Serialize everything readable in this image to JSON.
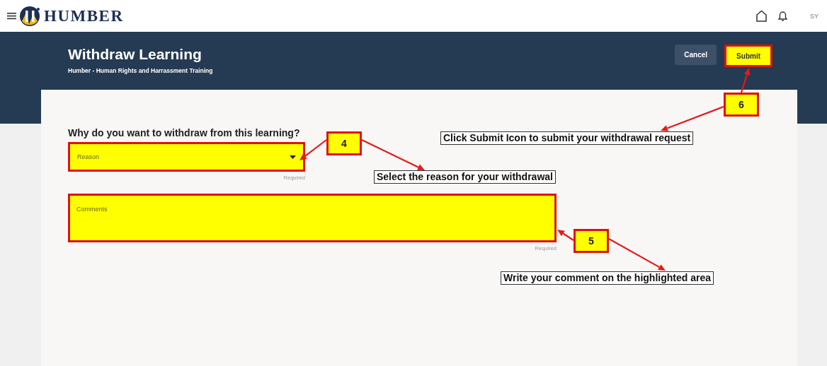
{
  "header": {
    "brand": "HUMBER",
    "user_initials": "SY"
  },
  "page": {
    "title": "Withdraw Learning",
    "subtitle": "Humber - Human Rights and Harrassment Training",
    "buttons": [
      {
        "label": "Cancel",
        "highlighted": false
      },
      {
        "label": "Submit",
        "highlighted": true
      }
    ]
  },
  "form": {
    "question": "Why do you want to withdraw from this learning?",
    "fields": [
      {
        "kind": "select",
        "placeholder": "Reason",
        "helper": "Required",
        "highlighted": true
      },
      {
        "kind": "textarea",
        "placeholder": "Comments",
        "helper": "Required",
        "highlighted": true
      }
    ]
  },
  "annotations": [
    {
      "number": "6",
      "note": "Click Submit Icon to submit your withdrawal request"
    },
    {
      "number": "4",
      "note": "Select the reason for your withdrawal"
    },
    {
      "number": "5",
      "note": "Write your comment on the highlighted area"
    }
  ]
}
